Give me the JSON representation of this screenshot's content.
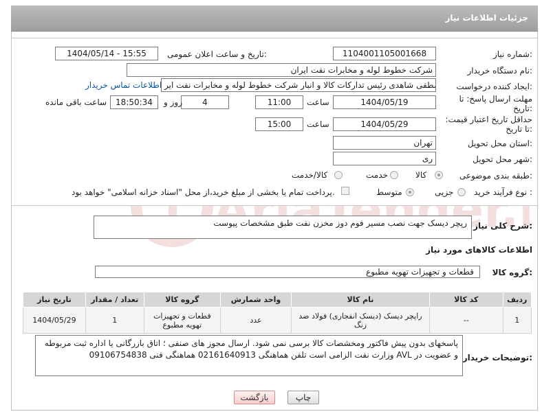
{
  "header": {
    "title": "جزئیات اطلاعات نیاز"
  },
  "form": {
    "need_number_label": "شماره نیاز:",
    "need_number": "1104001105001668",
    "announce_label": "تاریخ و ساعت اعلان عمومی:",
    "announce_value": "1404/05/14 - 15:55",
    "buyer_org_label": "نام دستگاه خریدار:",
    "buyer_org": "شرکت خطوط لوله و مخابرات نفت ایران",
    "creator_label": "ایجاد کننده درخواست:",
    "creator": "مصطفی  شاهدی رئیس تدارکات کالا و انبار شرکت خطوط لوله و مخابرات نفت ایر",
    "buyer_contact_link": "اطلاعات تماس خریدار",
    "reply_deadline_label": "مهلت ارسال پاسخ: تا تاریخ:",
    "reply_date": "1404/05/19",
    "time_label": "ساعت",
    "reply_time": "11:00",
    "days": "4",
    "days_label": "روز و",
    "remaining_time": "18:50:34",
    "remaining_label": "ساعت باقی مانده",
    "price_validity_label": "حداقل تاریخ اعتبار قیمت: تا تاریخ:",
    "price_date": "1404/05/29",
    "price_time": "15:00",
    "province_label": "استان محل تحویل:",
    "province": "تهران",
    "city_label": "شهر محل تحویل:",
    "city": "ری",
    "category_label": "طبقه بندی موضوعی:",
    "category_options": [
      "کالا",
      "خدمت",
      "کالا/خدمت"
    ],
    "purchase_type_label": "نوع فرآیند خرید :",
    "purchase_options": [
      "جزیی",
      "متوسط"
    ],
    "payment_note": "پرداخت تمام یا بخشی از مبلغ خرید،از محل \"اسناد خزانه اسلامی\" خواهد بود."
  },
  "description": {
    "label": "شرح کلی نیاز:",
    "text": "رپچر دیسک جهت نصب مسیر فوم دوز مخزن نفت طبق مشخصات پیوست"
  },
  "goods": {
    "section_title": "اطلاعات کالاهای مورد نیاز",
    "group_label": "گروه کالا:",
    "group_value": "قطعات و تجهیزات تهویه مطبوع",
    "columns": [
      "ردیف",
      "کد کالا",
      "نام کالا",
      "واحد شمارش",
      "گروه کالا",
      "تعداد / مقدار",
      "تاریخ نیاز"
    ],
    "rows": [
      [
        "1",
        "--",
        "راپچر دیسک (دیسک انفجاری) فولاد ضد زنگ",
        "عدد",
        "قطعات و تجهیزات تهویه مطبوع",
        "1",
        "1404/05/29"
      ]
    ]
  },
  "buyer_notes": {
    "label": "توضیحات خریدار:",
    "text": "پاسخهای بدون پیش فاکتور ومخشصات کالا برسی نمی شود. ارسال مجوز های صنفی ؛ اتاق بازرگانی یا اداره ثبت  مربوطه و عضویت در AVL وزارت نفت الزامی است تلفن هماهنگی  02161640913 هماهنگی فنی 09106754838"
  },
  "buttons": {
    "print": "چاپ",
    "back": "بازگشت"
  },
  "watermark": {
    "text": "AriaTender.net"
  },
  "colors": {
    "header": "#a9a9a9",
    "link": "#0a56a8",
    "watermark": "#e7b9b9"
  }
}
